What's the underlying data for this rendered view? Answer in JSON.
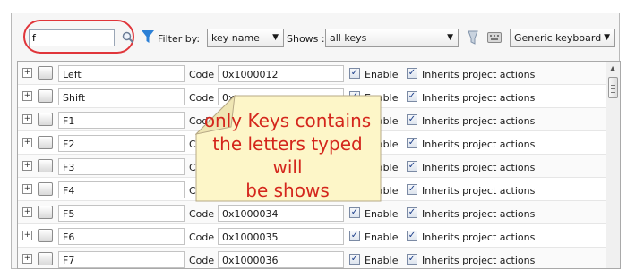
{
  "search": {
    "value": "f"
  },
  "toolbar": {
    "filter_label": "Filter by:",
    "filter_value": "key name",
    "shows_label": "Shows :",
    "shows_value": "all keys",
    "keyboard_value": "Generic keyboard"
  },
  "rows": [
    {
      "key": "Left",
      "code": "0x1000012",
      "enable_label": "Enable",
      "inherit_label": "Inherits project actions"
    },
    {
      "key": "Shift",
      "code": "0x",
      "enable_label": "Enable",
      "inherit_label": "Inherits project actions"
    },
    {
      "key": "F1",
      "code": "",
      "enable_label": "Enable",
      "inherit_label": "Inherits project actions"
    },
    {
      "key": "F2",
      "code": "",
      "enable_label": "Enable",
      "inherit_label": "Inherits project actions"
    },
    {
      "key": "F3",
      "code": "",
      "enable_label": "Enable",
      "inherit_label": "Inherits project actions"
    },
    {
      "key": "F4",
      "code": "",
      "enable_label": "Enable",
      "inherit_label": "Inherits project actions"
    },
    {
      "key": "F5",
      "code": "0x1000034",
      "enable_label": "Enable",
      "inherit_label": "Inherits project actions"
    },
    {
      "key": "F6",
      "code": "0x1000035",
      "enable_label": "Enable",
      "inherit_label": "Inherits project actions"
    },
    {
      "key": "F7",
      "code": "0x1000036",
      "enable_label": "Enable",
      "inherit_label": "Inherits project actions"
    }
  ],
  "code_label": "Code",
  "callout": {
    "line1": "only Keys contains",
    "line2": "the letters typed will",
    "line3": "be shows"
  },
  "colors": {
    "highlight": "#e0353a",
    "callout_fill": "#fdf6c8",
    "callout_text": "#d4261c"
  }
}
